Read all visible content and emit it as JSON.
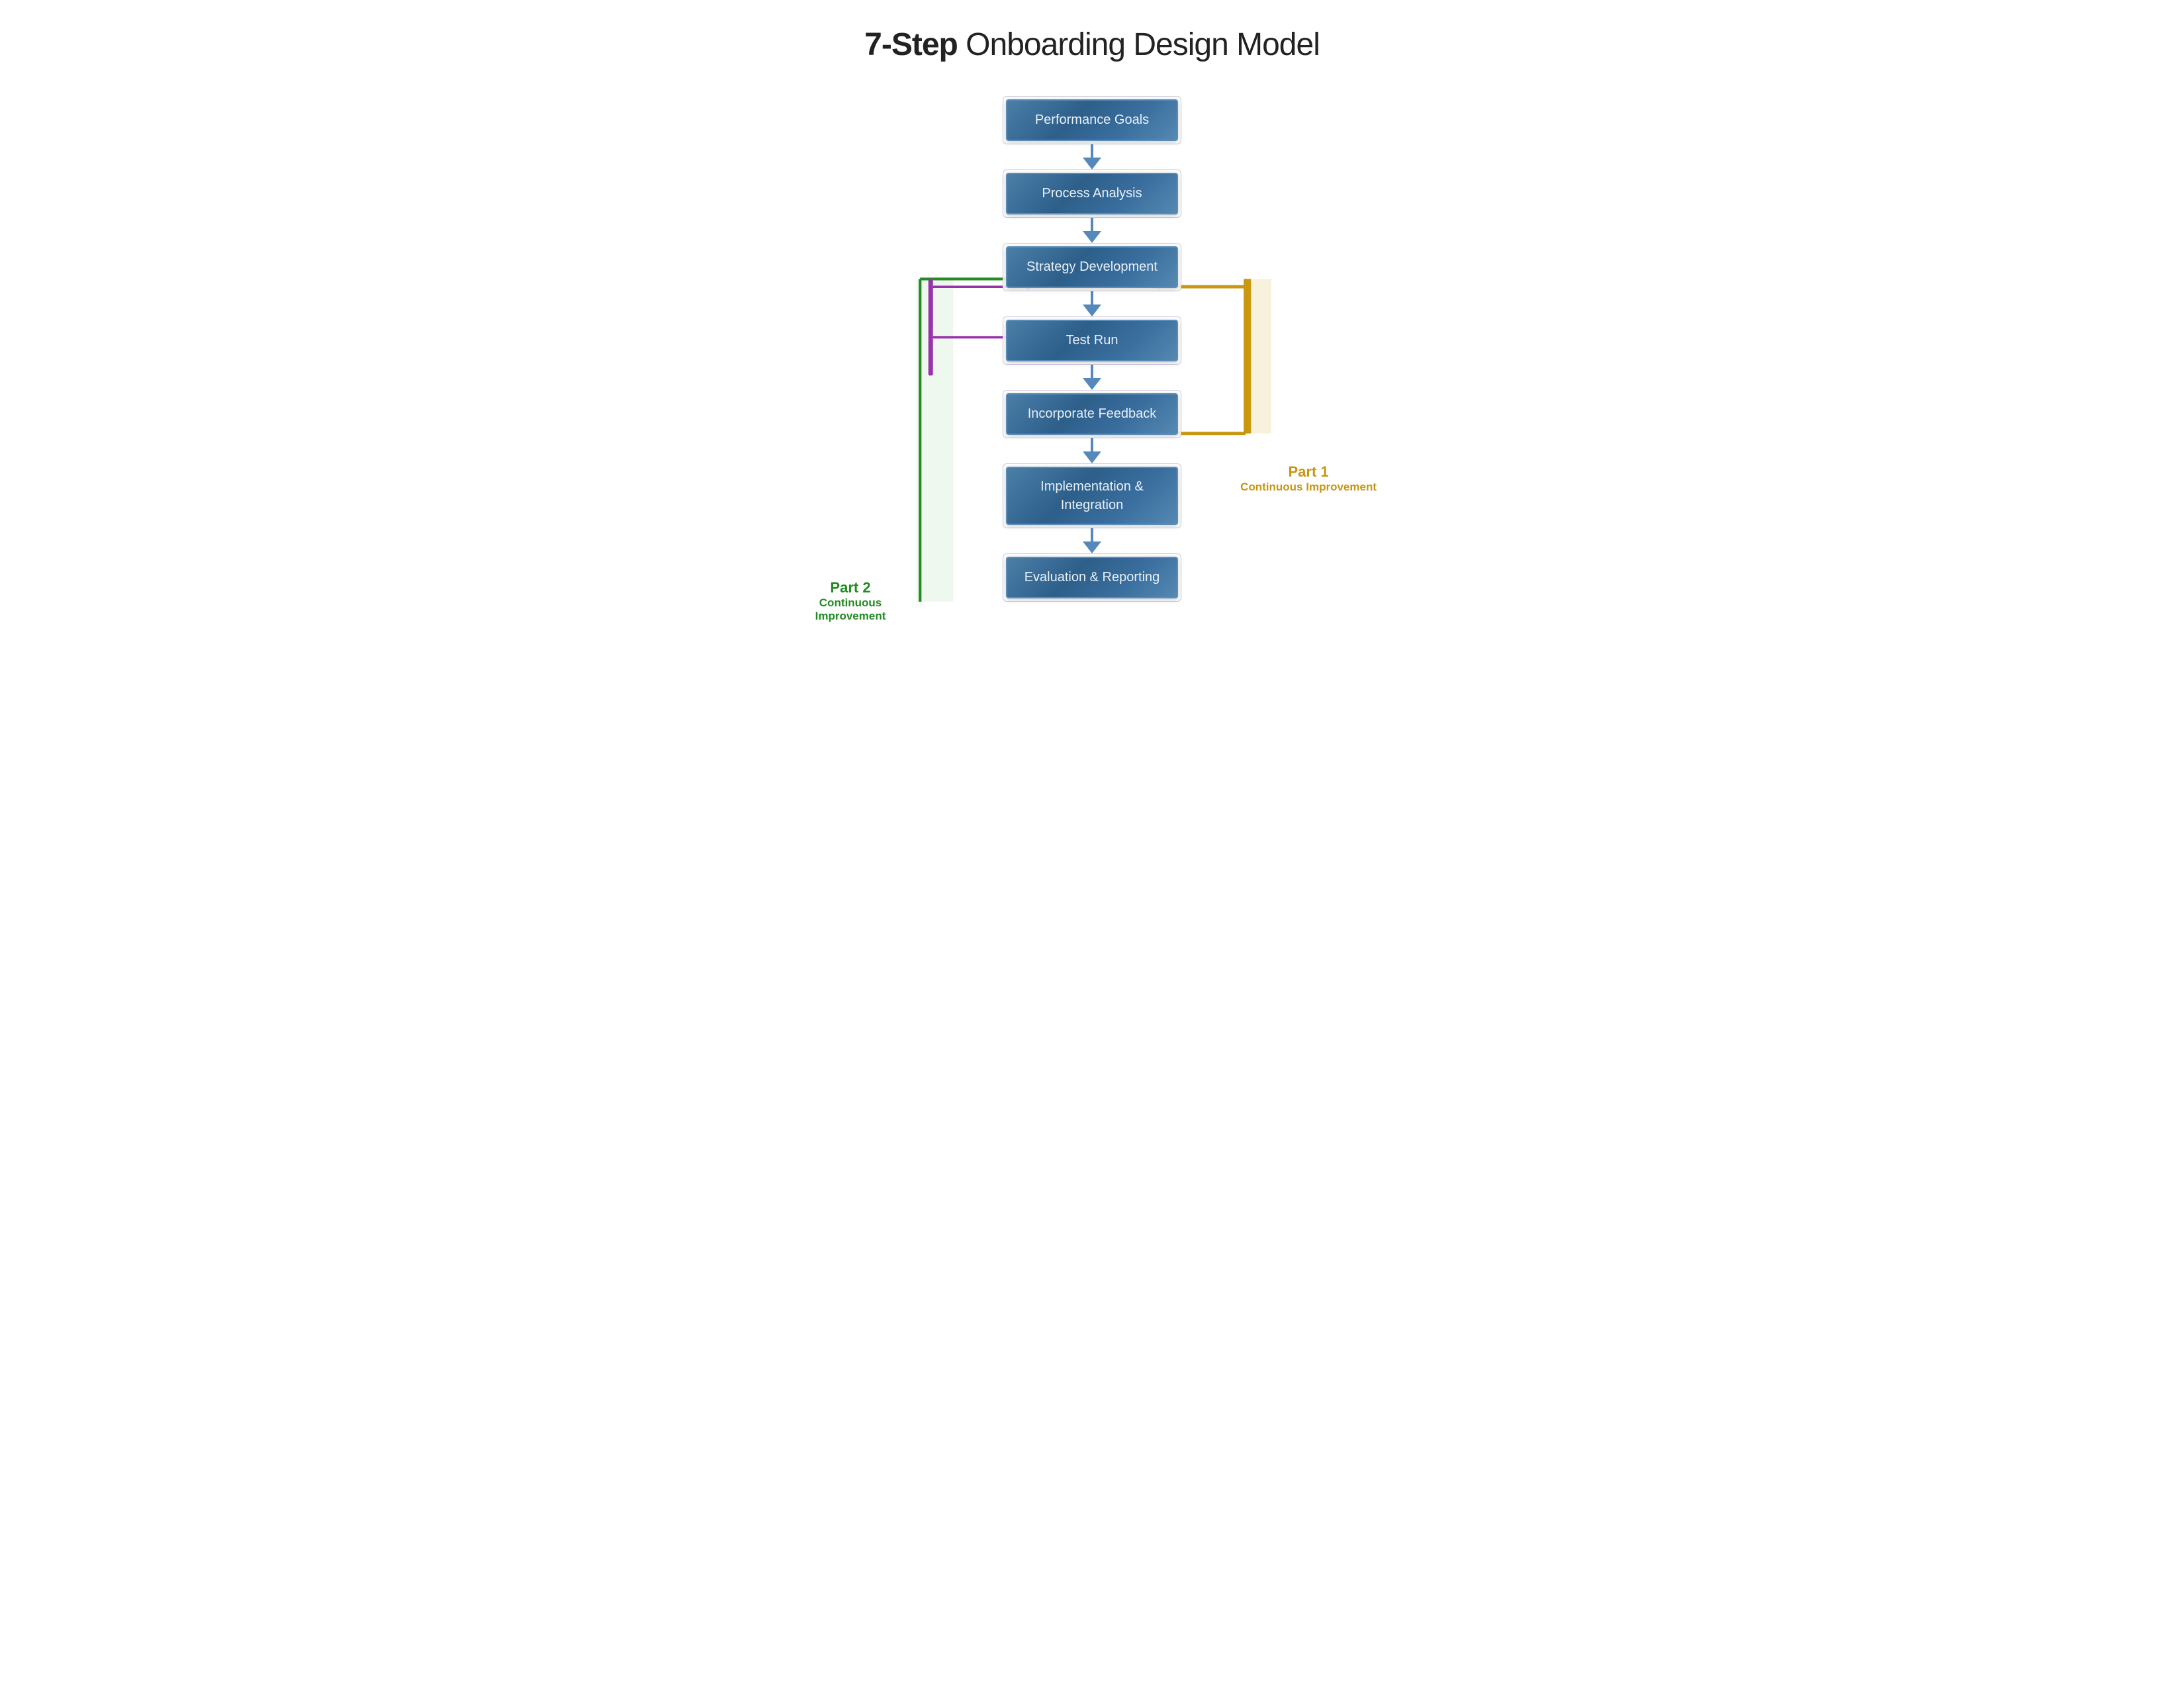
{
  "title": {
    "bold_part": "7-Step",
    "regular_part": " Onboarding Design Model"
  },
  "steps": [
    {
      "id": 1,
      "label": "Performance Goals"
    },
    {
      "id": 2,
      "label": "Process Analysis"
    },
    {
      "id": 3,
      "label": "Strategy Development"
    },
    {
      "id": 4,
      "label": "Test Run"
    },
    {
      "id": 5,
      "label": "Incorporate Feedback"
    },
    {
      "id": 6,
      "label": "Implementation &\nIntegration"
    },
    {
      "id": 7,
      "label": "Evaluation & Reporting"
    }
  ],
  "part1": {
    "title": "Part 1",
    "subtitle": "Continuous Improvement"
  },
  "part2": {
    "title": "Part 2",
    "subtitle": "Continuous Improvement"
  },
  "colors": {
    "box_bg_start": "#4a7fa8",
    "box_bg_end": "#2d5f8a",
    "box_border": "#5b8db8",
    "box_text": "#e8f0f8",
    "arrow_color": "#5588bb",
    "part1_color": "#c8960f",
    "part2_color": "#228B22",
    "purple_color": "#9933aa"
  }
}
